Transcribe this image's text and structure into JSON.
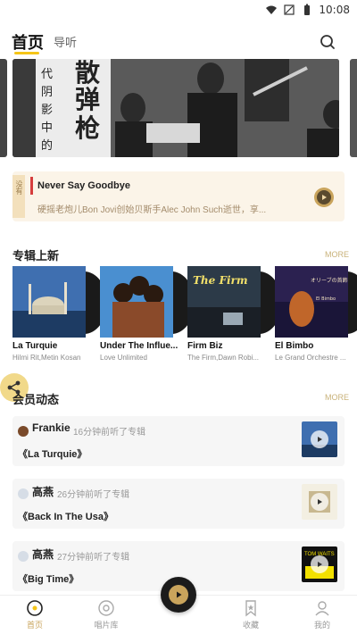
{
  "status_bar": {
    "time": "10:08"
  },
  "header": {
    "tab_home": "首页",
    "tab_listen": "导听"
  },
  "banner": {
    "chars_left": [
      "代",
      "阴",
      "影",
      "中",
      "的"
    ],
    "chars_big": [
      "散",
      "弹",
      "枪"
    ]
  },
  "now_playing": {
    "tag": "没有",
    "title": "Never Say Goodbye",
    "description": "硬摇老炮儿Bon Jovi创始贝斯手Alec John Such逝世，享..."
  },
  "albums_section": {
    "title": "专辑上新",
    "more": "MORE",
    "albums": [
      {
        "name": "La Turquie",
        "artist": "Hilmi Rit,Metin Kosan"
      },
      {
        "name": "Under The Influe...",
        "artist": "Love Unlimited"
      },
      {
        "name": "Firm Biz",
        "artist": "The Firm,Dawn Robi..."
      },
      {
        "name": "El Bimbo",
        "artist": "Le Grand Orchestre ..."
      }
    ],
    "cover_texts": [
      "The Firm",
      "オリーブの首飾り",
      "El Bimbo"
    ]
  },
  "activity_section": {
    "title": "会员动态",
    "more": "MORE",
    "items": [
      {
        "user": "Frankie",
        "action": "16分钟前听了专辑",
        "album": "《La Turquie》"
      },
      {
        "user": "高燕",
        "action": "26分钟前听了专辑",
        "album": "《Back In The Usa》"
      },
      {
        "user": "高燕",
        "action": "27分钟前听了专辑",
        "album": "《Big Time》"
      }
    ],
    "thumb_text": "TOM WAITS"
  },
  "bottom_nav": {
    "items": [
      {
        "label": "首页",
        "active": true
      },
      {
        "label": "唱片库",
        "active": false
      },
      {
        "label": "收藏",
        "active": false
      },
      {
        "label": "我的",
        "active": false
      }
    ]
  },
  "colors": {
    "accent": "#c9a45c",
    "highlight": "#f5c518"
  }
}
